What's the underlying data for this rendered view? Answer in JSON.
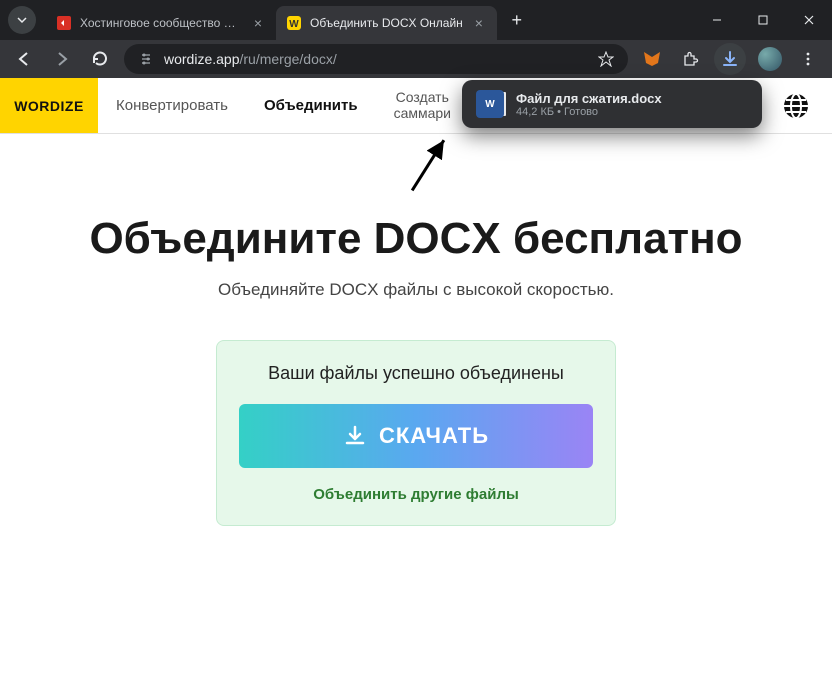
{
  "browser": {
    "tabs": [
      {
        "title": "Хостинговое сообщество «Tim",
        "favicon_color": "#d93025"
      },
      {
        "title": "Объединить DOCX Онлайн",
        "favicon_color": "#ffd400"
      }
    ],
    "url_host": "wordize.app",
    "url_path": "/ru/merge/docx/"
  },
  "download": {
    "filename": "Файл для сжатия.docx",
    "meta": "44,2 КБ • Готово",
    "icon_label": "W"
  },
  "site_nav": {
    "logo": "WORDIZE",
    "items": {
      "convert": "Конвертировать",
      "merge": "Объединить",
      "summary_line1": "Создать",
      "summary_line2": "саммари"
    }
  },
  "page": {
    "heading": "Объедините DOCX бесплатно",
    "subtitle": "Объединяйте DOCX файлы с высокой скоростью.",
    "card_title": "Ваши файлы успешно объединены",
    "download_label": "СКАЧАТЬ",
    "merge_again": "Объединить другие файлы"
  }
}
